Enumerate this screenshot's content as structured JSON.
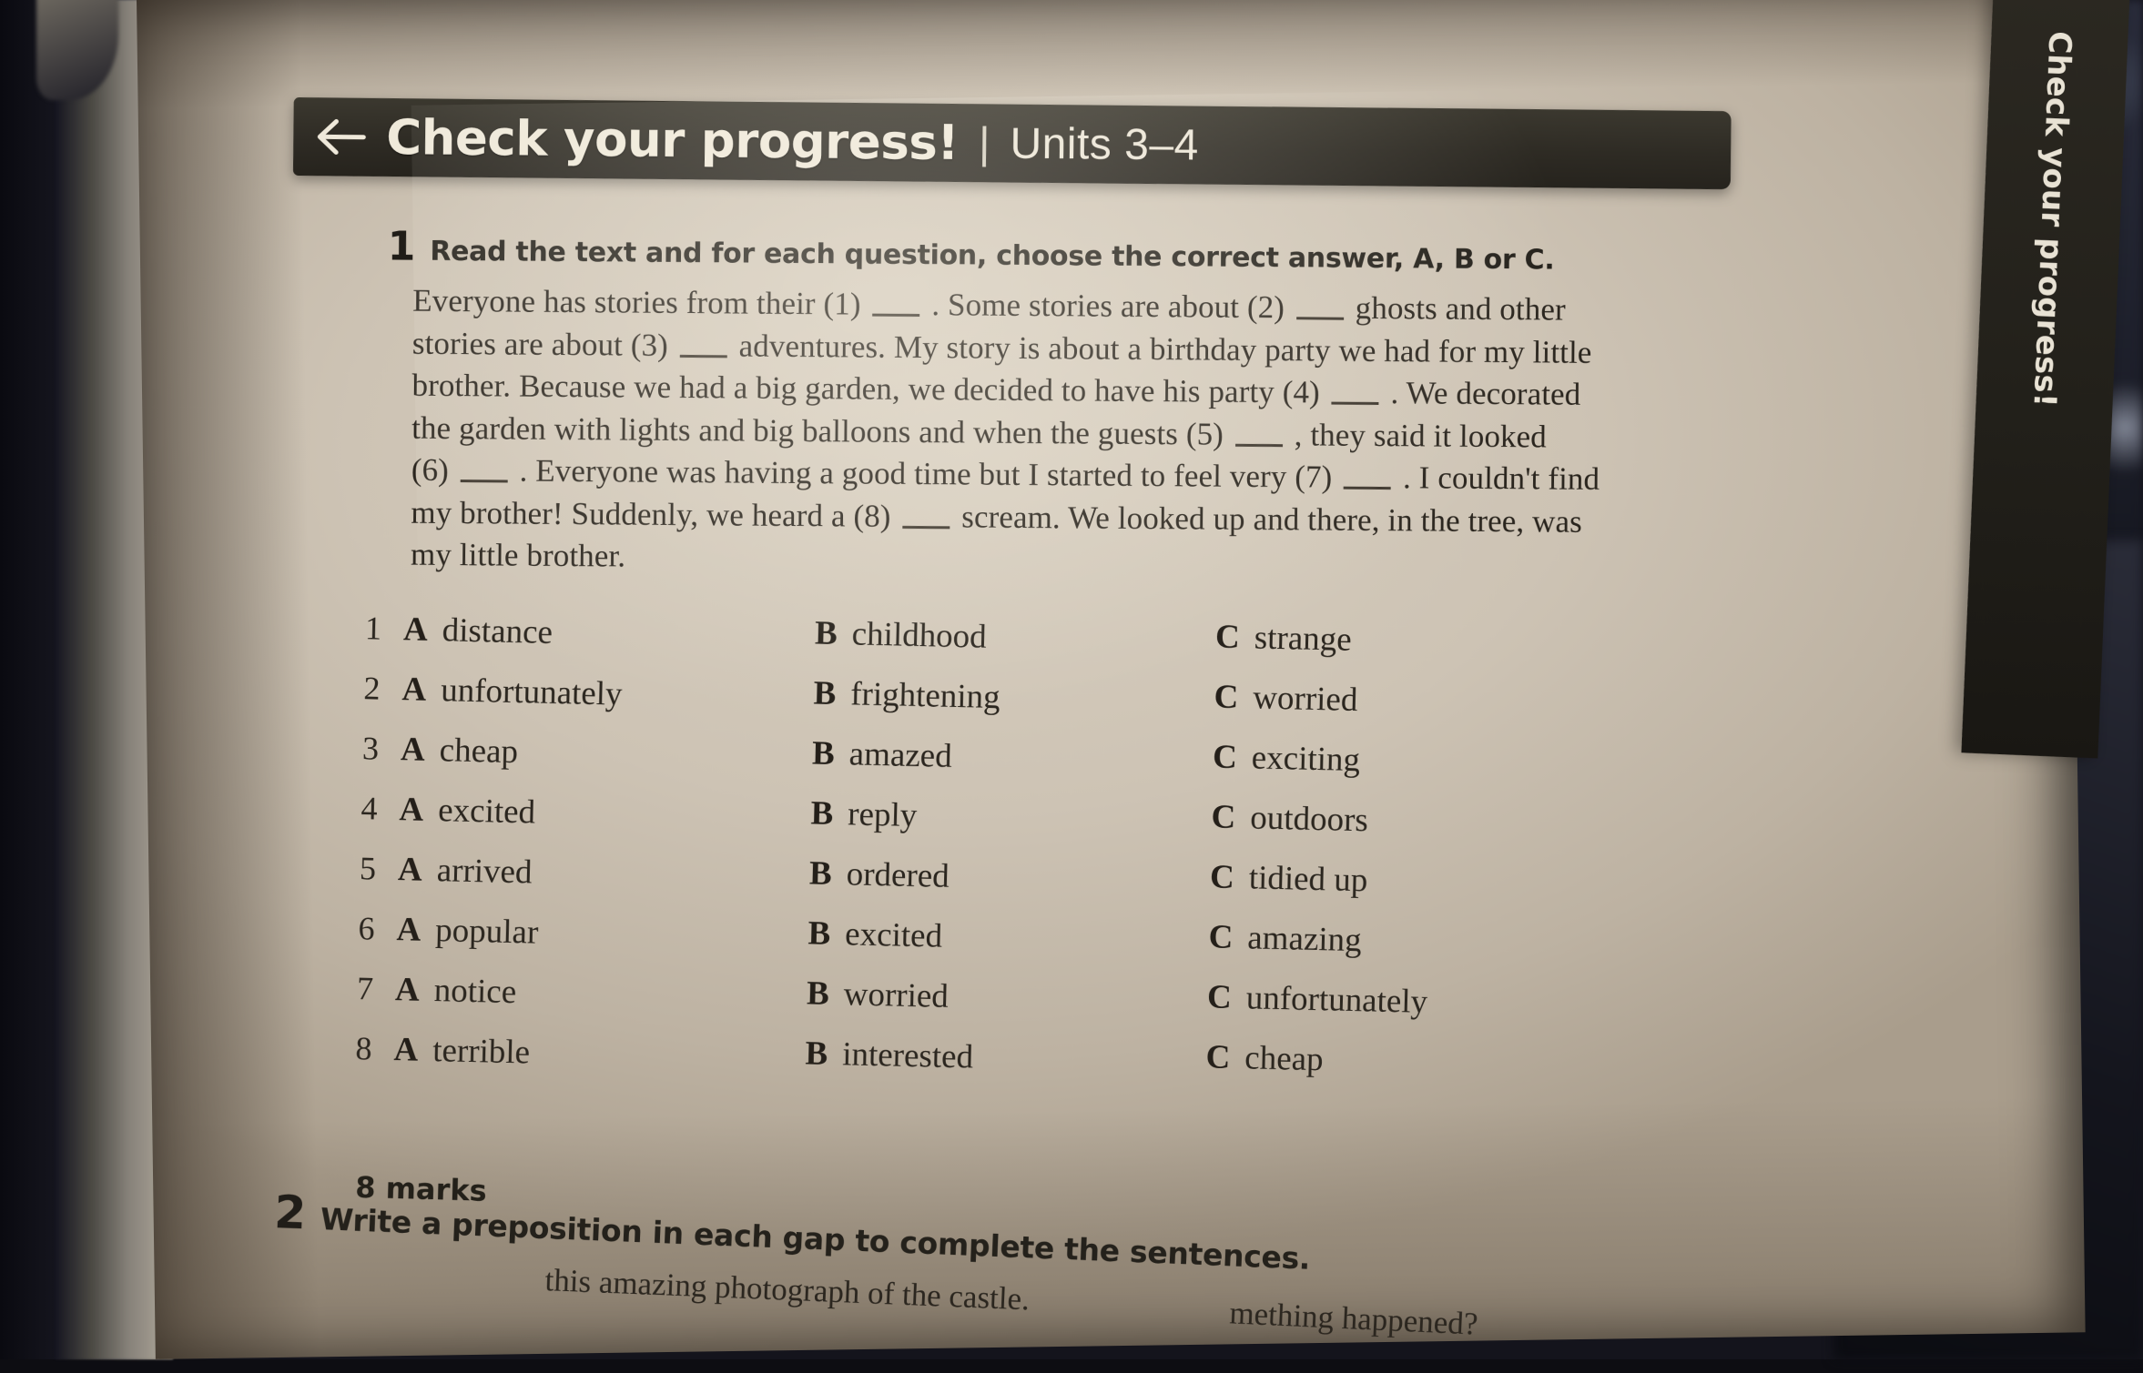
{
  "side_tab": {
    "label": "Check your progress!"
  },
  "header": {
    "back_icon": "back-arrow-icon",
    "title": "Check your progress!",
    "separator": "|",
    "units": "Units 3–4"
  },
  "exercise1": {
    "number": "1",
    "instruction": "Read the text and for each question, choose the correct answer, A, B or C.",
    "passage_lines": [
      "Everyone has stories from their (1) ___ . Some stories are about (2) ___ ghosts and other",
      "stories are about (3) ___ adventures. My story is about a birthday party we had for my little",
      "brother. Because we had a big garden, we decided to have his party (4) ___ . We decorated",
      "the garden with lights and big balloons and when the guests (5) ___ , they said it looked",
      "(6) ___ . Everyone was having a good time but I started to feel very (7) ___ . I couldn't find",
      "my brother! Suddenly, we heard a (8) ___ scream. We looked up and there, in the tree, was",
      "my little brother."
    ],
    "option_letters": {
      "a": "A",
      "b": "B",
      "c": "C"
    },
    "questions": [
      {
        "n": "1",
        "a": "distance",
        "b": "childhood",
        "c": "strange"
      },
      {
        "n": "2",
        "a": "unfortunately",
        "b": "frightening",
        "c": "worried"
      },
      {
        "n": "3",
        "a": "cheap",
        "b": "amazed",
        "c": "exciting"
      },
      {
        "n": "4",
        "a": "excited",
        "b": "reply",
        "c": "outdoors"
      },
      {
        "n": "5",
        "a": "arrived",
        "b": "ordered",
        "c": "tidied up"
      },
      {
        "n": "6",
        "a": "popular",
        "b": "excited",
        "c": "amazing"
      },
      {
        "n": "7",
        "a": "notice",
        "b": "worried",
        "c": "unfortunately"
      },
      {
        "n": "8",
        "a": "terrible",
        "b": "interested",
        "c": "cheap"
      }
    ],
    "marks": "8 marks"
  },
  "exercise2": {
    "number": "2",
    "instruction": "Write a preposition in each gap to complete the sentences.",
    "line1": "this amazing photograph of the castle.",
    "line2": "mething happened?"
  },
  "colors": {
    "banner_bg": "#2e2b24",
    "banner_text": "#efe9da",
    "paper": "#cdc3b4",
    "ink": "#2a251e"
  }
}
